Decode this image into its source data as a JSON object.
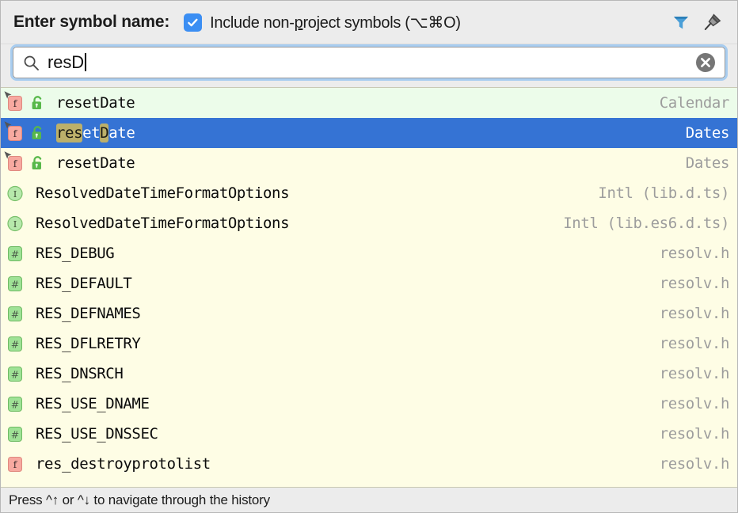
{
  "header": {
    "title": "Enter symbol name:",
    "checkbox": {
      "checked": true,
      "label_before": "Include non-",
      "label_mnemonic": "p",
      "label_after": "roject symbols (⌥⌘O)",
      "full_label": "Include non-project symbols (⌥⌘O)"
    },
    "filter_icon": "filter-funnel-icon",
    "pin_icon": "pushpin-icon",
    "accent_color": "#3b8ef3"
  },
  "search": {
    "icon": "search-icon",
    "value": "resD",
    "placeholder": "",
    "clear_icon": "clear-circle-icon",
    "focus_ring_color": "#a8cdf0"
  },
  "list": {
    "selected_index": 1,
    "selected_bg": "#3573d4",
    "first_row_bg": "#ecfcea",
    "default_bg": "#fefde5",
    "highlight_bg": "#bcb06a",
    "rows": [
      {
        "icon": "function-file-icon",
        "icon_kind": "f-pink",
        "has_cursor_badge": true,
        "lock": "unlocked-padlock-icon",
        "name": "resetDate",
        "match_ranges": [],
        "location": "Calendar"
      },
      {
        "icon": "function-file-icon",
        "icon_kind": "f-pink",
        "has_cursor_badge": true,
        "lock": "unlocked-padlock-icon",
        "name": "resetDate",
        "match_ranges": [
          [
            0,
            3
          ],
          [
            5,
            6
          ]
        ],
        "location": "Dates"
      },
      {
        "icon": "function-file-icon",
        "icon_kind": "f-pink",
        "has_cursor_badge": true,
        "lock": "unlocked-padlock-icon",
        "name": "resetDate",
        "match_ranges": [],
        "location": "Dates"
      },
      {
        "icon": "interface-icon",
        "icon_kind": "i-green-circle",
        "has_cursor_badge": false,
        "lock": null,
        "name": "ResolvedDateTimeFormatOptions",
        "match_ranges": [],
        "location": "Intl (lib.d.ts)"
      },
      {
        "icon": "interface-icon",
        "icon_kind": "i-green-circle",
        "has_cursor_badge": false,
        "lock": null,
        "name": "ResolvedDateTimeFormatOptions",
        "match_ranges": [],
        "location": "Intl (lib.es6.d.ts)"
      },
      {
        "icon": "macro-define-icon",
        "icon_kind": "hash-green",
        "has_cursor_badge": false,
        "lock": null,
        "name": "RES_DEBUG",
        "match_ranges": [],
        "location": "resolv.h"
      },
      {
        "icon": "macro-define-icon",
        "icon_kind": "hash-green",
        "has_cursor_badge": false,
        "lock": null,
        "name": "RES_DEFAULT",
        "match_ranges": [],
        "location": "resolv.h"
      },
      {
        "icon": "macro-define-icon",
        "icon_kind": "hash-green",
        "has_cursor_badge": false,
        "lock": null,
        "name": "RES_DEFNAMES",
        "match_ranges": [],
        "location": "resolv.h"
      },
      {
        "icon": "macro-define-icon",
        "icon_kind": "hash-green",
        "has_cursor_badge": false,
        "lock": null,
        "name": "RES_DFLRETRY",
        "match_ranges": [],
        "location": "resolv.h"
      },
      {
        "icon": "macro-define-icon",
        "icon_kind": "hash-green",
        "has_cursor_badge": false,
        "lock": null,
        "name": "RES_DNSRCH",
        "match_ranges": [],
        "location": "resolv.h"
      },
      {
        "icon": "macro-define-icon",
        "icon_kind": "hash-green",
        "has_cursor_badge": false,
        "lock": null,
        "name": "RES_USE_DNAME",
        "match_ranges": [],
        "location": "resolv.h"
      },
      {
        "icon": "macro-define-icon",
        "icon_kind": "hash-green",
        "has_cursor_badge": false,
        "lock": null,
        "name": "RES_USE_DNSSEC",
        "match_ranges": [],
        "location": "resolv.h"
      },
      {
        "icon": "function-icon",
        "icon_kind": "f-pink-plain",
        "has_cursor_badge": false,
        "lock": null,
        "name": "res_destroyprotolist",
        "match_ranges": [],
        "location": "resolv.h"
      }
    ]
  },
  "statusbar": {
    "text": "Press ^↑ or ^↓ to navigate through the history"
  }
}
